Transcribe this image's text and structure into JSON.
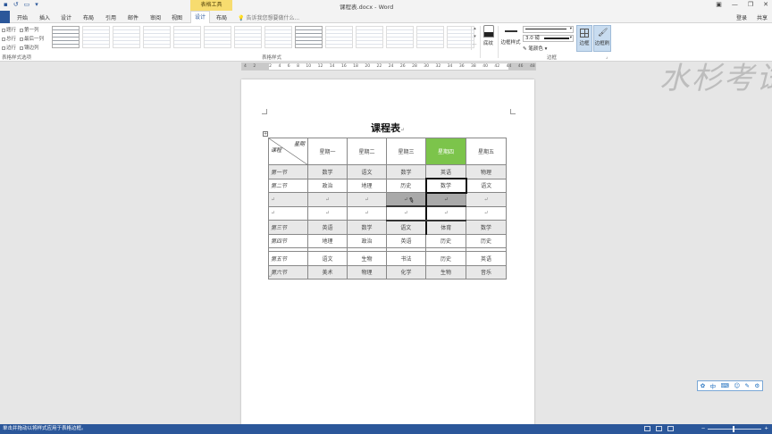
{
  "app": {
    "doc_title": "课程表.docx - Word",
    "context_tool": "表格工具",
    "sign_in": "登录",
    "share": "共享"
  },
  "tabs": [
    "开始",
    "插入",
    "设计",
    "布局",
    "引用",
    "邮件",
    "审阅",
    "视图",
    "设计",
    "布局"
  ],
  "active_tab_index": 8,
  "tell_me": "告诉我您想要做什么...",
  "ribbon": {
    "style_options": [
      "题行",
      "第一列",
      "总行",
      "最后一列",
      "边行",
      "镶边列"
    ],
    "style_options_label": "表格样式选项",
    "table_styles_label": "表格样式",
    "shading_label": "底纹",
    "border_styles_label": "边框样式",
    "line_weight": "3.0 磅",
    "pen_color_label": "笔颜色",
    "borders_label": "边框",
    "border_painter_label": "边框刷",
    "borders_group_label": "边框",
    "swatch_count": 14
  },
  "ruler_marks": [
    "4",
    "2",
    "",
    "2",
    "4",
    "6",
    "8",
    "10",
    "12",
    "14",
    "16",
    "18",
    "20",
    "22",
    "24",
    "26",
    "28",
    "30",
    "32",
    "34",
    "36",
    "38",
    "40",
    "42",
    "44",
    "46",
    "48"
  ],
  "doc": {
    "heading": "课程表",
    "para_mark": "↵",
    "diag_top": "星期",
    "diag_bottom": "课程",
    "days": [
      "星期一",
      "星期二",
      "星期三",
      "星期四",
      "星期五"
    ],
    "rows": [
      {
        "label": "第一节",
        "cells": [
          "数学",
          "语文",
          "数学",
          "英语",
          "物理"
        ]
      },
      {
        "label": "第二节",
        "cells": [
          "政治",
          "地理",
          "历史",
          "数学",
          "语文"
        ]
      },
      {
        "label": "",
        "cells": [
          "",
          "",
          "",
          "",
          ""
        ]
      },
      {
        "label": "",
        "cells": [
          "",
          "",
          "",
          "",
          ""
        ]
      },
      {
        "label": "第三节",
        "cells": [
          "英语",
          "数学",
          "语文",
          "体育",
          "数学"
        ]
      },
      {
        "label": "第四节",
        "cells": [
          "地理",
          "政治",
          "英语",
          "历史",
          "历史"
        ]
      },
      {
        "label": "第五节",
        "cells": [
          "语文",
          "生物",
          "书法",
          "历史",
          "英语"
        ]
      },
      {
        "label": "第六节",
        "cells": [
          "美术",
          "物理",
          "化学",
          "生物",
          "音乐"
        ]
      }
    ]
  },
  "watermark": "水杉考试",
  "ime": [
    "✿",
    "中",
    "⌨",
    "☺",
    "✎",
    "⚙"
  ],
  "status": {
    "message": "单击并拖动以将样式应用于表格边框。"
  },
  "colors": {
    "word_blue": "#2b579a",
    "context_yellow": "#f7dc6f",
    "highlight_green": "#7cc44b"
  }
}
